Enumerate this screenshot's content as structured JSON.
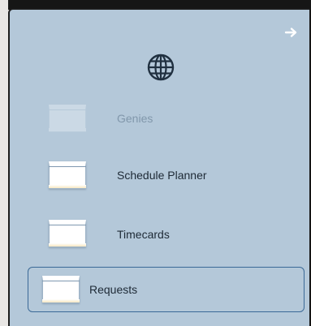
{
  "panel": {
    "collapse_icon": "arrow-right-icon",
    "brand_icon": "globe-icon"
  },
  "nav": {
    "items": [
      {
        "label": "Genies",
        "icon": "card-icon",
        "enabled": false,
        "active": false
      },
      {
        "label": "Schedule Planner",
        "icon": "card-icon",
        "enabled": true,
        "active": false
      },
      {
        "label": "Timecards",
        "icon": "card-icon",
        "enabled": true,
        "active": false
      },
      {
        "label": "Requests",
        "icon": "card-icon",
        "enabled": true,
        "active": true
      }
    ]
  },
  "colors": {
    "panel_background": "#b4c8d9",
    "active_border": "#3a6996",
    "label_text": "#1e2a36",
    "disabled_text": "#8197ab"
  }
}
